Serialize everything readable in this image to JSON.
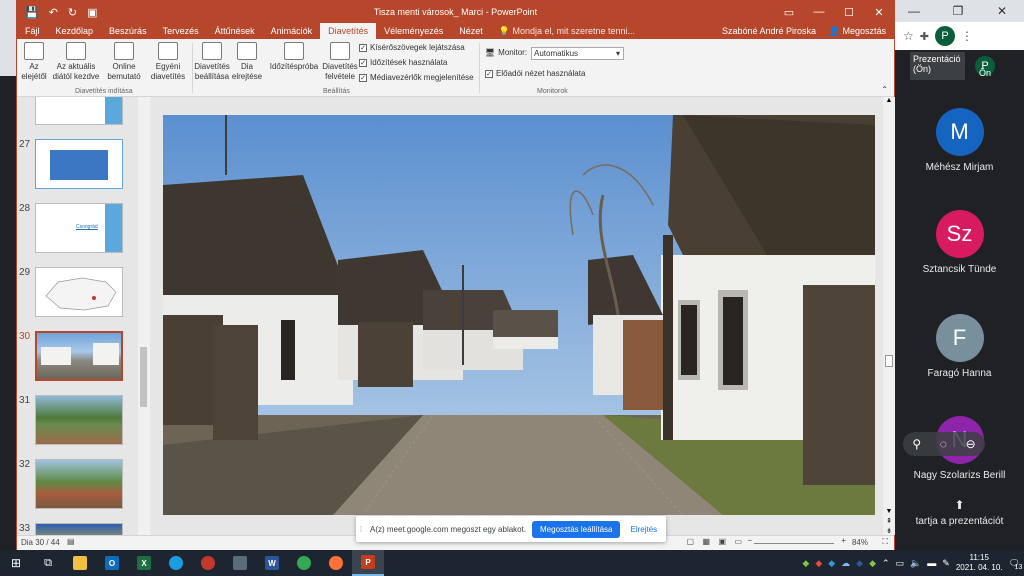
{
  "chrome": {
    "profile_initial": "P"
  },
  "meet": {
    "presenting_tile": "Prezentáció (Ön)",
    "self_label": "Ön",
    "self_initial": "P",
    "participants": [
      {
        "initial": "M",
        "name": "Méhész Mirjam",
        "color": "#1565c0"
      },
      {
        "initial": "Sz",
        "name": "Sztancsik Tünde",
        "color": "#d81b60"
      },
      {
        "initial": "F",
        "name": "Faragó Hanna",
        "color": "#78909c"
      },
      {
        "initial": "N",
        "name": "Nagy Szolarizs Berill",
        "color": "#8e24aa"
      }
    ],
    "stop_presenting": "tartja a prezentációt"
  },
  "ppt": {
    "window_title": "Tisza menti városok_ Marci - PowerPoint",
    "tabs": [
      "Fájl",
      "Kezdőlap",
      "Beszúrás",
      "Tervezés",
      "Áttűnések",
      "Animációk",
      "Diavetítés",
      "Véleményezés",
      "Nézet"
    ],
    "active_tab": "Diavetítés",
    "search_placeholder": "Mondja el, mit szeretne tenni...",
    "user": "Szabóné André Piroska",
    "share": "Megosztás",
    "ribbon": {
      "from_beginning": "Az elejétől",
      "from_current": "Az aktuális diától kezdve",
      "online": "Online bemutató",
      "custom": "Egyéni diavetítés",
      "group1": "Diavetítés indítása",
      "setup": "Diavetítés beállítása",
      "hide": "Dia elrejtése",
      "rehearse": "Időzítéspróba",
      "record": "Diavetítés felvétele",
      "chk_narration": "Kísérőszövegek lejátszása",
      "chk_timings": "Időzítések használata",
      "chk_media": "Médiavezérlők megjelenítése",
      "group2": "Beállítás",
      "monitor_label": "Monitor:",
      "monitor_value": "Automatikus",
      "presenter_view": "Előadói nézet használata",
      "group3": "Monitorok"
    },
    "slide_numbers": [
      "27",
      "28",
      "29",
      "30",
      "31",
      "32",
      "33"
    ],
    "active_slide": "30",
    "thumb28_link": "Csongrád",
    "status_slide": "Dia 30 / 44",
    "zoom": "84%"
  },
  "share_notice": {
    "message": "A(z) meet.google.com megoszt egy ablakot.",
    "stop": "Megosztás leállítása",
    "hide": "Elrejtés"
  },
  "taskbar": {
    "time": "11:15",
    "date": "2021. 04. 10.",
    "notifications": "13"
  }
}
